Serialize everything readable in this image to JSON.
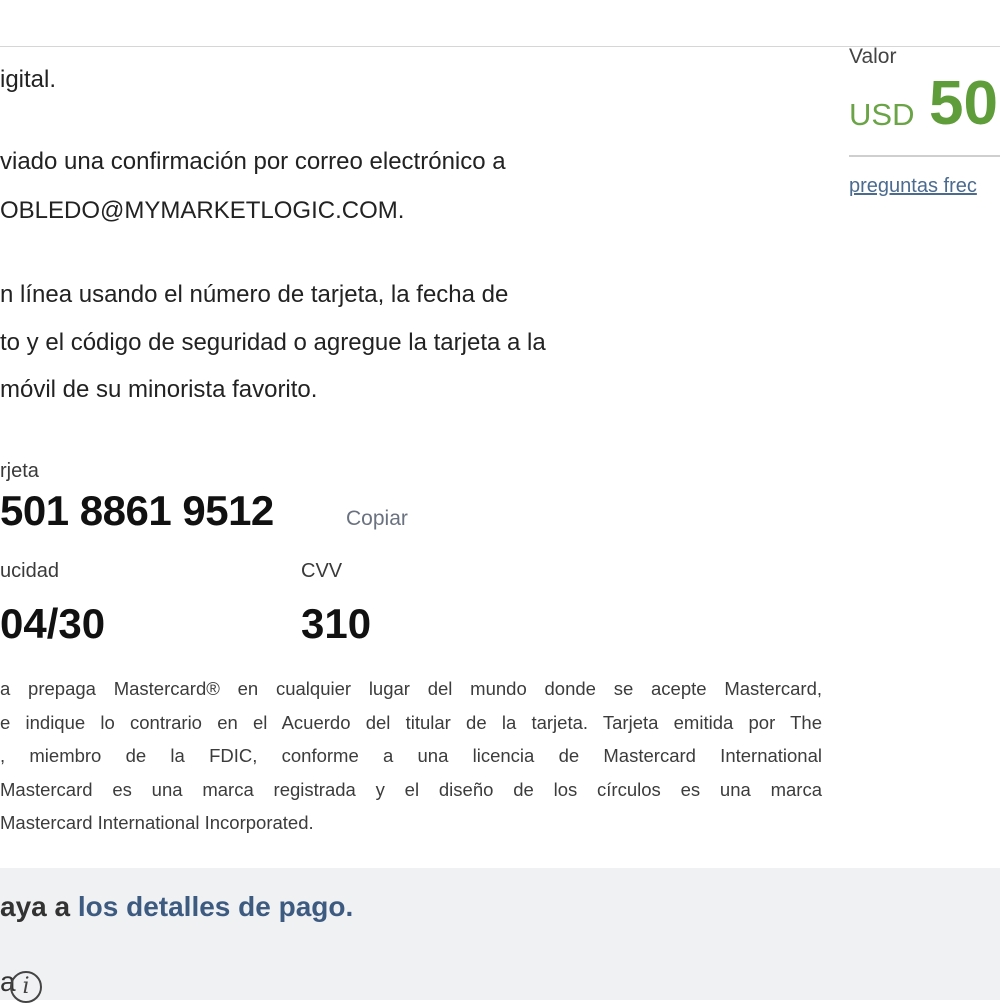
{
  "content": {
    "paragraph1": "igital.",
    "paragraph2_line1": "viado una confirmación por correo electrónico a",
    "paragraph2_line2": "OBLEDO@MYMARKETLOGIC.COM.",
    "paragraph3_line1": "n línea usando el número de tarjeta, la fecha de",
    "paragraph3_line2": "to y el código de seguridad o agregue la tarjeta a la",
    "paragraph3_line3": "móvil de su minorista favorito."
  },
  "card": {
    "number_label": "rjeta",
    "number": "501 8861 9512",
    "copy_label": "Copiar",
    "expiry_label": "ucidad",
    "expiry": "04/30",
    "cvv_label": "CVV",
    "cvv": "310"
  },
  "legal": [
    "a prepaga Mastercard® en cualquier lugar del mundo donde se acepte Mastercard,",
    "e indique lo contrario en el Acuerdo del titular de la tarjeta. Tarjeta emitida por The",
    ", miembro de la FDIC, conforme a una licencia de Mastercard International",
    "Mastercard es una marca registrada y el diseño de los círculos es una marca",
    "Mastercard International Incorporated."
  ],
  "footer": {
    "text_prefix": "aya a ",
    "link": "los detalles de pago.",
    "tail": "a"
  },
  "sidebar": {
    "value_label": "Valor",
    "currency": "USD",
    "amount": "50",
    "faq_link": "preguntas frec"
  },
  "icons": {
    "info": "info-icon"
  },
  "colors": {
    "amount_green": "#5f9c3a",
    "link_blue": "#3d5a80",
    "footer_bg": "#f0f1f3"
  }
}
